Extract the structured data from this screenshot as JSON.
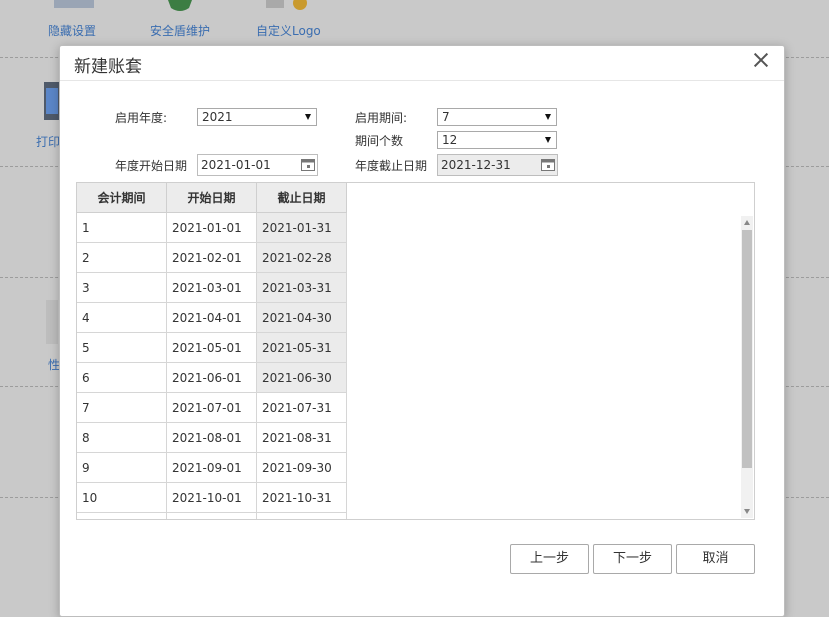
{
  "background": {
    "top_items": [
      {
        "label": "隐藏设置"
      },
      {
        "label": "安全盾维护"
      },
      {
        "label": "自定义Logo"
      }
    ],
    "side_items": [
      {
        "label": "打印"
      },
      {
        "label": "性"
      }
    ]
  },
  "dialog": {
    "title": "新建账套",
    "form": {
      "start_year_label": "启用年度:",
      "start_year_value": "2021",
      "start_period_label": "启用期间:",
      "start_period_value": "7",
      "period_count_label": "期间个数",
      "period_count_value": "12",
      "year_start_label": "年度开始日期",
      "year_start_value": "2021-01-01",
      "year_end_label": "年度截止日期",
      "year_end_value": "2021-12-31"
    },
    "table": {
      "headers": [
        "会计期间",
        "开始日期",
        "截止日期"
      ],
      "rows": [
        [
          "1",
          "2021-01-01",
          "2021-01-31"
        ],
        [
          "2",
          "2021-02-01",
          "2021-02-28"
        ],
        [
          "3",
          "2021-03-01",
          "2021-03-31"
        ],
        [
          "4",
          "2021-04-01",
          "2021-04-30"
        ],
        [
          "5",
          "2021-05-01",
          "2021-05-31"
        ],
        [
          "6",
          "2021-06-01",
          "2021-06-30"
        ],
        [
          "7",
          "2021-07-01",
          "2021-07-31"
        ],
        [
          "8",
          "2021-08-01",
          "2021-08-31"
        ],
        [
          "9",
          "2021-09-01",
          "2021-09-30"
        ],
        [
          "10",
          "2021-10-01",
          "2021-10-31"
        ]
      ]
    },
    "buttons": {
      "prev": "上一步",
      "next": "下一步",
      "cancel": "取消"
    }
  }
}
